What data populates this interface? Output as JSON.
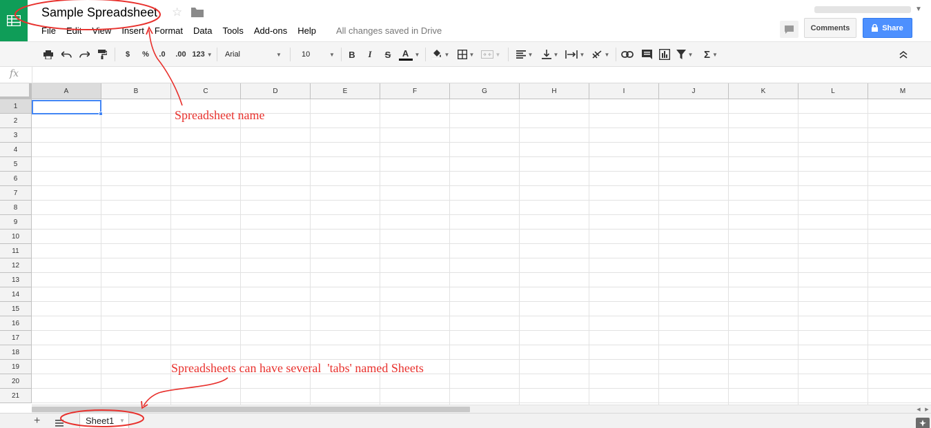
{
  "doc": {
    "title": "Sample Spreadsheet",
    "save_status": "All changes saved in Drive"
  },
  "menu": [
    "File",
    "Edit",
    "View",
    "Insert",
    "Format",
    "Data",
    "Tools",
    "Add-ons",
    "Help"
  ],
  "header": {
    "comments_label": "Comments",
    "share_label": "Share"
  },
  "toolbar": {
    "currency_label": "$",
    "percent_label": "%",
    "decrease_decimal_label": ".0",
    "increase_decimal_label": ".00",
    "more_formats_label": "123",
    "font_family": "Arial",
    "font_size": "10",
    "bold_label": "B",
    "italic_label": "I",
    "strike_label": "S",
    "text_color_label": "A",
    "sum_label": "Σ"
  },
  "formula_bar": {
    "fx_label": "fx",
    "value": ""
  },
  "grid": {
    "columns": [
      "A",
      "B",
      "C",
      "D",
      "E",
      "F",
      "G",
      "H",
      "I",
      "J",
      "K",
      "L",
      "M"
    ],
    "rows": [
      "1",
      "2",
      "3",
      "4",
      "5",
      "6",
      "7",
      "8",
      "9",
      "10",
      "11",
      "12",
      "13",
      "14",
      "15",
      "16",
      "17",
      "18",
      "19",
      "20",
      "21"
    ],
    "selected_cell": "A1"
  },
  "sheets": {
    "tabs": [
      "Sheet1"
    ],
    "active": "Sheet1"
  },
  "annotations": {
    "title_note": "Spreadsheet name",
    "tabs_note": "Spreadsheets can have several  'tabs' named Sheets"
  },
  "colors": {
    "logo_green": "#0f9d58",
    "share_blue": "#4d90fe",
    "selection_blue": "#4285f4",
    "annotation_red": "#e8312d"
  }
}
